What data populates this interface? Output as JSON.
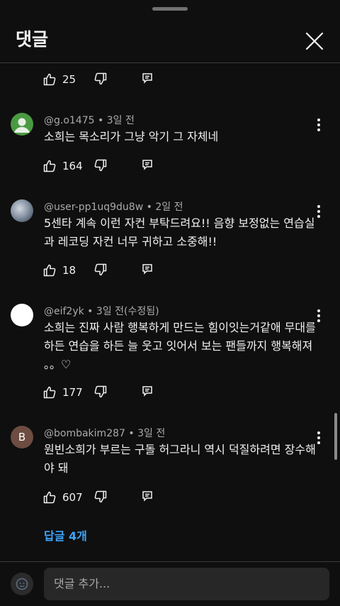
{
  "header": {
    "title": "댓글"
  },
  "partial_item": {
    "likes": "25"
  },
  "comments": [
    {
      "author": "@g.o1475",
      "time": "3일 전",
      "text": "소희는 목소리가 그냥 악기 그 자체네",
      "likes": "164"
    },
    {
      "author": "@user-pp1uq9du8w",
      "time": "2일 전",
      "text": "5센타 계속 이런 자컨 부탁드려요!! 음향 보정없는 연습실과 레코딩 자컨 너무 귀하고 소중해!!",
      "likes": "18"
    },
    {
      "author": "@eif2yk",
      "time": "3일 전(수정됨)",
      "text": "소희는 진짜 사람 행복하게 만드는 힘이잇는거같애 무대를 하든 연습을 하든 늘 웃고 잇어서 보는 팬들까지 행복해져 。。♡",
      "likes": "177"
    },
    {
      "author": "@bombakim287",
      "time": "3일 전",
      "text": "원빈소희가 부르는 구돌 허그라니 역시 덕질하려면 장수해야 돼",
      "likes": "607",
      "avatar_letter": "B"
    }
  ],
  "replies_link": "답글 4개",
  "input": {
    "placeholder": "댓글 추가..."
  },
  "colors": {
    "link": "#3ea6ff",
    "background": "#0f0f0f",
    "meta": "#aaaaaa"
  }
}
